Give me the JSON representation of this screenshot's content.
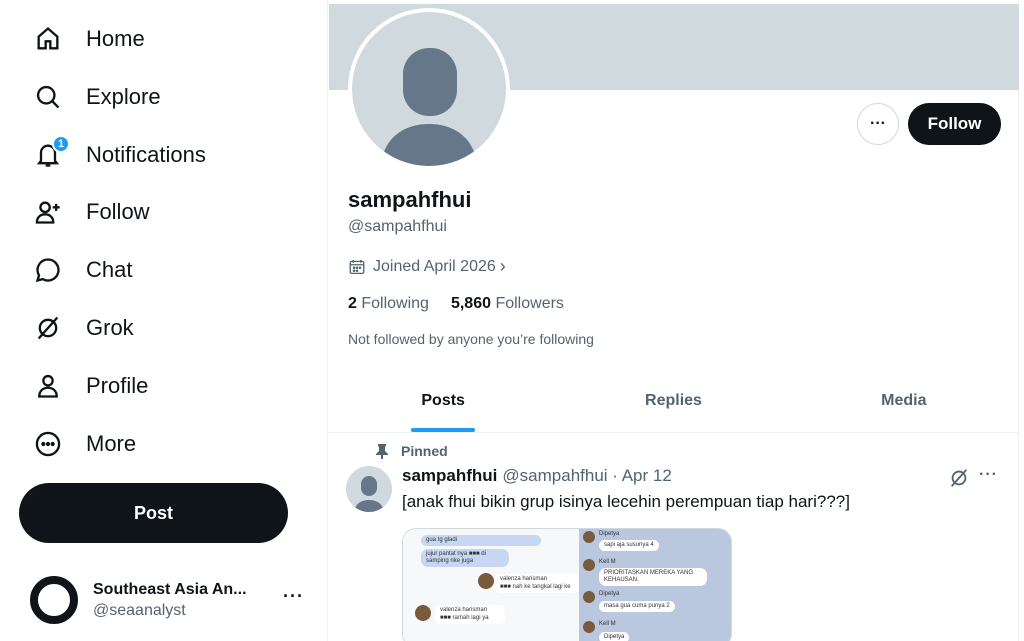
{
  "sidebar": {
    "items": [
      {
        "label": "Home",
        "icon": "home-icon"
      },
      {
        "label": "Explore",
        "icon": "search-icon"
      },
      {
        "label": "Notifications",
        "icon": "bell-icon",
        "badge": "1"
      },
      {
        "label": "Follow",
        "icon": "person-plus-icon"
      },
      {
        "label": "Chat",
        "icon": "chat-bubble-icon"
      },
      {
        "label": "Grok",
        "icon": "grok-icon"
      },
      {
        "label": "Profile",
        "icon": "person-icon"
      },
      {
        "label": "More",
        "icon": "more-circle-icon"
      }
    ],
    "post_button": "Post",
    "account": {
      "name": "Southeast Asia An...",
      "handle": "@seaanalyst",
      "more": "···"
    }
  },
  "profile": {
    "display_name": "sampahfhui",
    "handle": "@sampahfhui",
    "joined": "Joined April 2026",
    "following_count": "2",
    "following_label": "Following",
    "followers_count": "5,860",
    "followers_label": "Followers",
    "not_followed": "Not followed by anyone you’re following",
    "follow_button": "Follow",
    "more_button": "···"
  },
  "tabs": [
    {
      "label": "Posts",
      "active": true
    },
    {
      "label": "Replies",
      "active": false
    },
    {
      "label": "Media",
      "active": false
    }
  ],
  "post": {
    "pinned_label": "Pinned",
    "author": "sampahfhui",
    "meta": "@sampahfhui · Apr 12",
    "text": "[anak fhui bikin grup isinya lecehin perempuan tiap hari???]",
    "more": "···",
    "image_text": {
      "b1": "gua tg gladi",
      "b2": "jujur pantat nya ■■■ di samping nke juga",
      "n1": "valenza harisman",
      "b3": "■■■ nah ke tangkal lagi ke",
      "n2": "valenza harisman",
      "b4": "■■■ ramah lagi ya",
      "r_n1": "Dipetya",
      "r1": "sapi aja susunya 4",
      "r_n2": "Kell M",
      "r2": "PRIORITASKAN MEREKA YANG KEHAUSAN.",
      "r_n3": "Dipetya",
      "r3": "masa gua cuma punya 2",
      "r_n4": "Kell M",
      "r_n5": "Dipetya"
    }
  },
  "colors": {
    "accent": "#1d9bf0",
    "text": "#0f1419",
    "muted": "#536471",
    "banner": "#cfd9de"
  }
}
